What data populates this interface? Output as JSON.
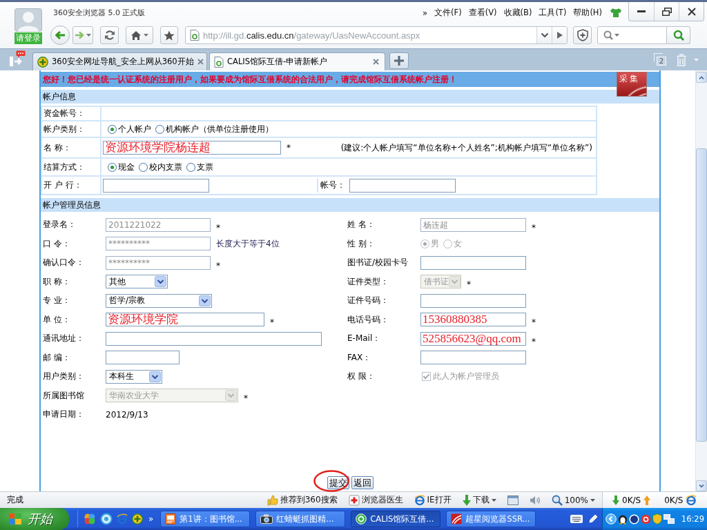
{
  "browser": {
    "title": "360安全浏览器 5.0 正式版",
    "login": "请登录",
    "menu_more": "»",
    "menu": [
      "文件(F)",
      "查看(V)",
      "收藏(B)",
      "工具(T)",
      "帮助(H)"
    ],
    "url": "http://ill.gd.**calis.edu.cn**/gateway/UasNewAccount.aspx"
  },
  "tabs": {
    "items": [
      {
        "kind": "portal",
        "label": "360安全网址导航_安全上网从360开始",
        "selected": false
      },
      {
        "kind": "page",
        "label": "CALIS馆际互借-申请新帐户",
        "selected": true
      }
    ],
    "count": "2"
  },
  "page": {
    "notice": "您好！您已经是统一认证系统的注册用户，如果要成为馆际互借系统的合法用户，请完成馆际互借系统帐户注册！",
    "logo": "采集",
    "account": {
      "title": "帐户信息",
      "rows": [
        {
          "kind": "blank",
          "label": "资金帐号："
        },
        {
          "kind": "radios",
          "label": "帐户类别：",
          "options": [
            {
              "label": "个人帐户",
              "selected": true
            },
            {
              "label": "机构帐户（供单位注册使用）",
              "selected": false
            }
          ]
        },
        {
          "kind": "text",
          "label": "名 称：",
          "value": "资源环境学院杨连超",
          "annotated": true,
          "required_mark": "*",
          "note": "(建议:个人帐户填写“单位名称+个人姓名”;机构帐户填写“单位名称”)"
        },
        {
          "kind": "radios",
          "label": "结算方式：",
          "options": [
            {
              "label": "现金",
              "selected": true
            },
            {
              "label": "校内支票",
              "selected": false
            },
            {
              "label": "支票",
              "selected": false
            }
          ]
        },
        {
          "kind": "pair",
          "label": "开 户 行：",
          "second_label": "帐号："
        }
      ]
    },
    "admin": {
      "title": "帐户管理员信息",
      "left": [
        {
          "kind": "text",
          "label": "登录名：",
          "value": "2011221022",
          "disabled": true,
          "annotated": false,
          "required_mark": "*"
        },
        {
          "kind": "text",
          "label": "口 令：",
          "value": "**********",
          "disabled": true,
          "annotated": false,
          "hint": "长度大于等于4位"
        },
        {
          "kind": "text",
          "label": "确认口令：",
          "value": "**********",
          "disabled": true,
          "annotated": false,
          "required_mark": "*"
        },
        {
          "kind": "select",
          "label": "职 称：",
          "value": "其他",
          "disabled": false
        },
        {
          "kind": "select",
          "label": "专 业：",
          "value": "哲学/宗教",
          "disabled": false
        },
        {
          "kind": "text",
          "label": "单 位：",
          "value": "资源环境学院",
          "disabled": false,
          "annotated": true,
          "required_mark": "*"
        },
        {
          "kind": "text",
          "label": "通讯地址："
        },
        {
          "kind": "text",
          "label": "邮 编："
        },
        {
          "kind": "select",
          "label": "用户类别：",
          "value": "本科生",
          "disabled": false
        },
        {
          "kind": "select",
          "label": "所属图书馆",
          "value": "华南农业大学",
          "disabled": true,
          "required_mark": "*"
        },
        {
          "kind": "static",
          "label": "申请日期：",
          "value": "2012/9/13"
        }
      ],
      "right": [
        {
          "kind": "text",
          "label": "姓 名：",
          "value": "杨连超",
          "disabled": true,
          "annotated": false,
          "required_mark": "*"
        },
        {
          "kind": "radios",
          "label": "性 别：",
          "disabled": true,
          "options": [
            {
              "label": "男",
              "selected": true
            },
            {
              "label": "女",
              "selected": false
            }
          ]
        },
        {
          "kind": "text",
          "label": "图书证/校园卡号"
        },
        {
          "kind": "select",
          "label": "证件类型：",
          "value": "借书证",
          "disabled": true,
          "required_mark": "*"
        },
        {
          "kind": "text",
          "label": "证件号码："
        },
        {
          "kind": "text",
          "label": "电话号码：",
          "value": "15360880385",
          "disabled": false,
          "annotated": true,
          "required_mark": "*"
        },
        {
          "kind": "text",
          "label": "E-Mail：",
          "value": "525856623@qq.com",
          "disabled": false,
          "annotated": true,
          "required_mark": "*"
        },
        {
          "kind": "text",
          "label": "FAX："
        },
        {
          "kind": "checkbox",
          "label": "权 限：",
          "disabled": true,
          "checked": true,
          "text": "此人为帐户管理员"
        }
      ]
    },
    "buttons": [
      {
        "label": "提交",
        "circled": true
      },
      {
        "label": "返回",
        "circled": false
      }
    ]
  },
  "status_bar": {
    "text": "完成",
    "items": [
      {
        "kind": "recommend",
        "label": "推荐到360搜索"
      },
      {
        "kind": "doctor",
        "label": "浏览器医生"
      },
      {
        "kind": "ie",
        "label": "IE打开"
      },
      {
        "kind": "download",
        "label": "下载"
      },
      {
        "kind": "window"
      },
      {
        "kind": "sound"
      },
      {
        "kind": "zoom",
        "label": "100%"
      }
    ],
    "down_speed": "0K/S",
    "up_speed": "0K/S"
  },
  "taskbar": {
    "start": "开始",
    "more": "»",
    "tasks": [
      {
        "kind": "slides",
        "label": "第1讲：图书馆...",
        "selected": false
      },
      {
        "kind": "camera",
        "label": "红蜻蜓抓图精...",
        "selected": false
      },
      {
        "kind": "browser",
        "label": "CALIS馆际互借...",
        "selected": true
      },
      {
        "kind": "reader",
        "label": "超星阅览器SSR...",
        "selected": false
      }
    ],
    "clock": "16:29"
  }
}
